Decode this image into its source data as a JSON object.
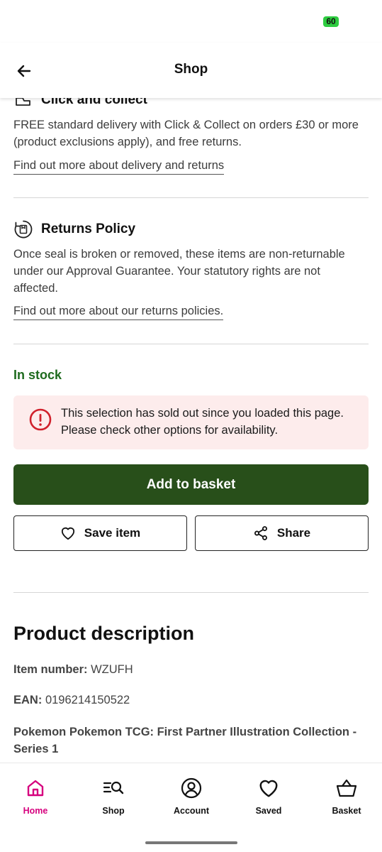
{
  "status": {
    "battery": "60"
  },
  "header": {
    "title": "Shop"
  },
  "delivery": {
    "title": "Click and collect",
    "text": "FREE standard delivery with Click & Collect on orders £30 or more (product exclusions apply), and free returns.",
    "link": "Find out more about delivery and returns"
  },
  "returns": {
    "title": "Returns Policy",
    "text": "Once seal is broken or removed, these items are non-returnable under our Approval Guarantee. Your statutory rights are not affected.",
    "link": "Find out more about our returns policies."
  },
  "stock": {
    "status": "In stock"
  },
  "alert": {
    "text": "This selection has sold out since you loaded this page. Please check other options for availability."
  },
  "actions": {
    "add_to_basket": "Add to basket",
    "save_item": "Save item",
    "share": "Share"
  },
  "product_description": {
    "title": "Product description",
    "item_number_label": "Item number:",
    "item_number": "WZUFH",
    "ean_label": "EAN:",
    "ean": "0196214150522",
    "name": "Pokemon Pokemon TCG: First Partner Illustration Collection - Series 1"
  },
  "nav": {
    "home": "Home",
    "shop": "Shop",
    "account": "Account",
    "saved": "Saved",
    "basket": "Basket"
  },
  "colors": {
    "accent": "#d6007e",
    "primary_button": "#284f1a",
    "in_stock": "#1e6b1e",
    "alert_bg": "#fdecec",
    "alert_icon": "#d0212c"
  }
}
